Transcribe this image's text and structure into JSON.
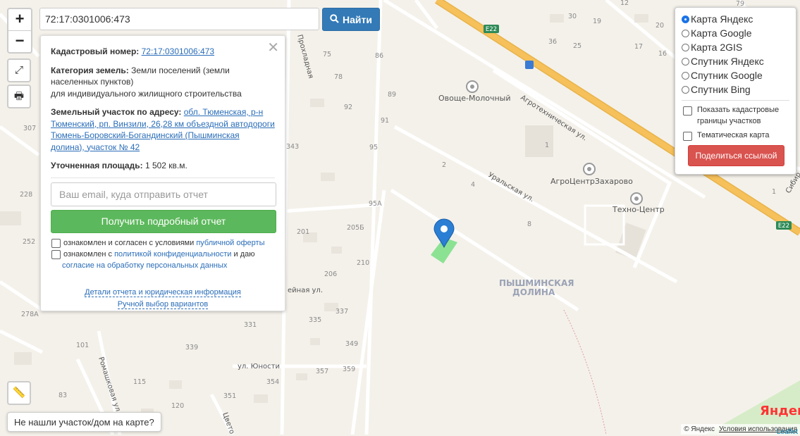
{
  "search": {
    "value": "72:17:0301006:473",
    "button_label": "Найти"
  },
  "zoom": {
    "in": "+",
    "out": "−"
  },
  "card": {
    "cadastral_label": "Кадастровый номер:",
    "cadastral_value": "72:17:0301006:473",
    "category_label": "Категория земель:",
    "category_value": "Земли поселений (земли населенных пунктов)",
    "category_use": "для индивидуального жилищного строительства",
    "address_label": "Земельный участок по адресу:",
    "address_value": "обл. Тюменская, р-н Тюменский, рп. Винзили, 26,28 км объездной автодороги Тюмень-Боровский-Богандинский (Пышминская долина), участок № 42",
    "area_label": "Уточненная площадь:",
    "area_value": "1 502 кв.м.",
    "email_placeholder": "Ваш email, куда отправить отчет",
    "report_button": "Получить подробный отчет",
    "agree1_text": "ознакомлен и согласен с условиями ",
    "agree1_link": "публичной оферты",
    "agree2_text": "ознакомлен с ",
    "agree2_link": "политикой конфиденциальности",
    "agree2_tail": " и даю",
    "agree2_link2": "согласие на обработку персональных данных",
    "details_link": "Детали отчета и юридическая информация",
    "manual_link": "Ручной выбор вариантов"
  },
  "layers": {
    "options": [
      {
        "label": "Карта Яндекс",
        "selected": true
      },
      {
        "label": "Карта Google",
        "selected": false
      },
      {
        "label": "Карта 2GIS",
        "selected": false
      },
      {
        "label": "Спутник Яндекс",
        "selected": false
      },
      {
        "label": "Спутник Google",
        "selected": false
      },
      {
        "label": "Спутник Bing",
        "selected": false
      }
    ],
    "show_borders": "Показать кадастровые границы участков",
    "thematic": "Тематическая карта",
    "share_button": "Поделиться ссылкой"
  },
  "not_found": "Не нашли участок/дом на карте?",
  "attribution": {
    "copy": "© Яндекс",
    "terms": "Условия использования",
    "leaflet": "Leaflet"
  },
  "map_labels": {
    "road_shield": "E22",
    "poi1": "Овоще-Молочный",
    "poi2": "АгроЦентрЗахарово",
    "poi3": "Техно-Центр",
    "street1": "Агротехническая ул.",
    "street2": "Уральская ул.",
    "street3": "ул. Юности",
    "street4": "Ромашковая ул.",
    "street5": "Прохладная",
    "street6": "ейная ул.",
    "street7": "Сибир",
    "street8": "Цвето",
    "district_line1": "ПЫШМИНСКАЯ",
    "district_line2": "ДОЛИНА",
    "logo": "Яндекс",
    "numbers": [
      "75",
      "86",
      "78",
      "89",
      "92",
      "91",
      "95",
      "95А",
      "2",
      "4",
      "8",
      "1",
      "201",
      "205Б",
      "206",
      "210",
      "337",
      "335",
      "331",
      "349",
      "339",
      "357",
      "359",
      "354",
      "351",
      "343",
      "307",
      "228",
      "252",
      "278А",
      "101",
      "83",
      "115",
      "120",
      "30",
      "36",
      "19",
      "25",
      "20",
      "12",
      "17",
      "1",
      "16",
      "79"
    ]
  },
  "colors": {
    "primary": "#337ab7",
    "success": "#5cb85c",
    "danger": "#d9534f",
    "highway": "#f6c05a",
    "parcel": "#7fe08a",
    "marker": "#2a7fd4"
  }
}
